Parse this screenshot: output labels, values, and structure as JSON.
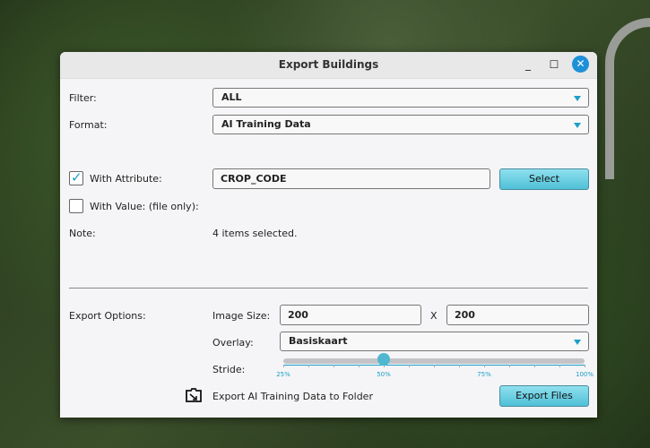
{
  "window": {
    "title": "Export Buildings"
  },
  "filter": {
    "label": "Filter:",
    "value": "ALL"
  },
  "format": {
    "label": "Format:",
    "value": "AI Training Data"
  },
  "with_attribute": {
    "label": "With Attribute:",
    "checked": true,
    "value": "CROP_CODE",
    "button": "Select"
  },
  "with_value": {
    "label": "With Value: (file only):",
    "checked": false
  },
  "note": {
    "label": "Note:",
    "value": "4 items selected."
  },
  "export_options": {
    "label": "Export Options:",
    "image_size_label": "Image Size:",
    "width": "200",
    "x_label": "X",
    "height": "200",
    "overlay_label": "Overlay:",
    "overlay_value": "Basiskaart",
    "stride_label": "Stride:",
    "stride_value_percent": 50,
    "stride_ticks": [
      "25%",
      "50%",
      "75%",
      "100%"
    ],
    "folder_text": "Export AI Training Data to Folder",
    "export_button": "Export Files"
  },
  "colors": {
    "accent": "#1aa0c8",
    "close": "#1e90d8"
  }
}
